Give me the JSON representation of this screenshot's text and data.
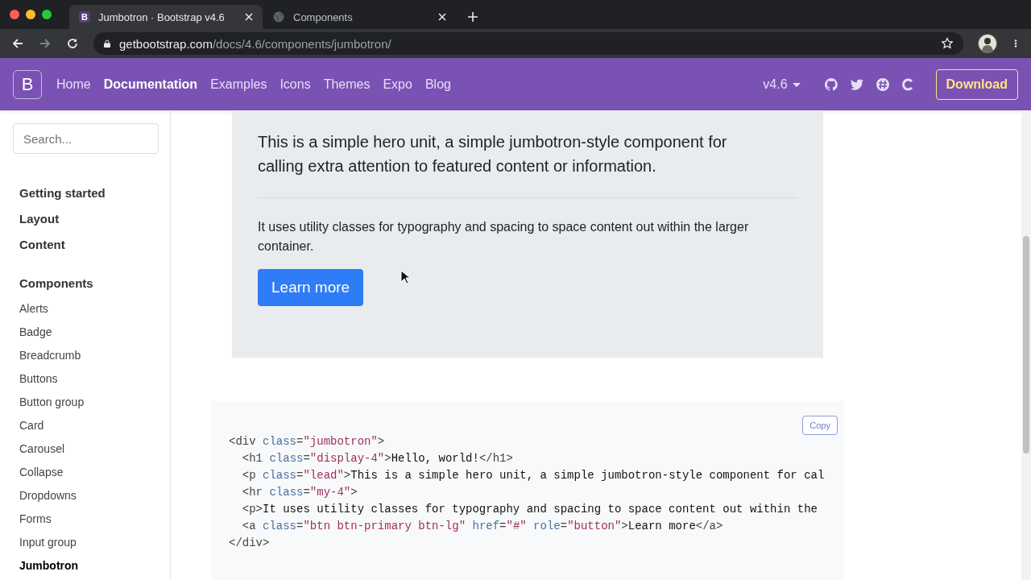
{
  "browser": {
    "tabs": [
      {
        "favicon_text": "B",
        "title": "Jumbotron · Bootstrap v4.6",
        "selected": true
      },
      {
        "title": "Components",
        "selected": false
      }
    ],
    "address": {
      "host": "getbootstrap.com",
      "path": "/docs/4.6/components/jumbotron/"
    }
  },
  "navbar": {
    "brand": "B",
    "links": [
      {
        "label": "Home",
        "selected": false
      },
      {
        "label": "Documentation",
        "selected": true
      },
      {
        "label": "Examples",
        "selected": false
      },
      {
        "label": "Icons",
        "selected": false
      },
      {
        "label": "Themes",
        "selected": false
      },
      {
        "label": "Expo",
        "selected": false
      },
      {
        "label": "Blog",
        "selected": false
      }
    ],
    "version": "v4.6",
    "download": "Download"
  },
  "sidebar": {
    "search": {
      "placeholder": "Search..."
    },
    "groups": [
      {
        "title": "Getting started"
      },
      {
        "title": "Layout"
      },
      {
        "title": "Content"
      },
      {
        "title": "Components",
        "items": [
          {
            "label": "Alerts",
            "selected": false
          },
          {
            "label": "Badge",
            "selected": false
          },
          {
            "label": "Breadcrumb",
            "selected": false
          },
          {
            "label": "Buttons",
            "selected": false
          },
          {
            "label": "Button group",
            "selected": false
          },
          {
            "label": "Card",
            "selected": false
          },
          {
            "label": "Carousel",
            "selected": false
          },
          {
            "label": "Collapse",
            "selected": false
          },
          {
            "label": "Dropdowns",
            "selected": false
          },
          {
            "label": "Forms",
            "selected": false
          },
          {
            "label": "Input group",
            "selected": false
          },
          {
            "label": "Jumbotron",
            "selected": true
          }
        ]
      }
    ]
  },
  "jumbotron": {
    "lead": "This is a simple hero unit, a simple jumbotron-style component for calling extra attention to featured content or information.",
    "text": "It uses utility classes for typography and spacing to space content out within the larger container.",
    "button": "Learn more"
  },
  "code": {
    "copy": "Copy",
    "lines": [
      [
        {
          "kind": "tag",
          "t": "<div "
        },
        {
          "kind": "attr",
          "t": "class"
        },
        {
          "kind": "tag",
          "t": "="
        },
        {
          "kind": "str",
          "t": "\"jumbotron\""
        },
        {
          "kind": "tag",
          "t": ">"
        }
      ],
      [
        {
          "kind": "tag",
          "t": "  <h1 "
        },
        {
          "kind": "attr",
          "t": "class"
        },
        {
          "kind": "tag",
          "t": "="
        },
        {
          "kind": "str",
          "t": "\"display-4\""
        },
        {
          "kind": "tag",
          "t": ">"
        },
        {
          "kind": "text",
          "t": "Hello, world!"
        },
        {
          "kind": "tag",
          "t": "</h1>"
        }
      ],
      [
        {
          "kind": "tag",
          "t": "  <p "
        },
        {
          "kind": "attr",
          "t": "class"
        },
        {
          "kind": "tag",
          "t": "="
        },
        {
          "kind": "str",
          "t": "\"lead\""
        },
        {
          "kind": "tag",
          "t": ">"
        },
        {
          "kind": "text",
          "t": "This is a simple hero unit, a simple jumbotron-style component for cal"
        }
      ],
      [
        {
          "kind": "tag",
          "t": "  <hr "
        },
        {
          "kind": "attr",
          "t": "class"
        },
        {
          "kind": "tag",
          "t": "="
        },
        {
          "kind": "str",
          "t": "\"my-4\""
        },
        {
          "kind": "tag",
          "t": ">"
        }
      ],
      [
        {
          "kind": "tag",
          "t": "  <p>"
        },
        {
          "kind": "text",
          "t": "It uses utility classes for typography and spacing to space content out within the"
        }
      ],
      [
        {
          "kind": "tag",
          "t": "  <a "
        },
        {
          "kind": "attr",
          "t": "class"
        },
        {
          "kind": "tag",
          "t": "="
        },
        {
          "kind": "str",
          "t": "\"btn btn-primary btn-lg\""
        },
        {
          "kind": "attr",
          "t": " href"
        },
        {
          "kind": "tag",
          "t": "="
        },
        {
          "kind": "str",
          "t": "\"#\""
        },
        {
          "kind": "attr",
          "t": " role"
        },
        {
          "kind": "tag",
          "t": "="
        },
        {
          "kind": "str",
          "t": "\"button\""
        },
        {
          "kind": "tag",
          "t": ">"
        },
        {
          "kind": "text",
          "t": "Learn more"
        },
        {
          "kind": "tag",
          "t": "</a>"
        }
      ],
      [
        {
          "kind": "tag",
          "t": "</div>"
        }
      ]
    ]
  }
}
